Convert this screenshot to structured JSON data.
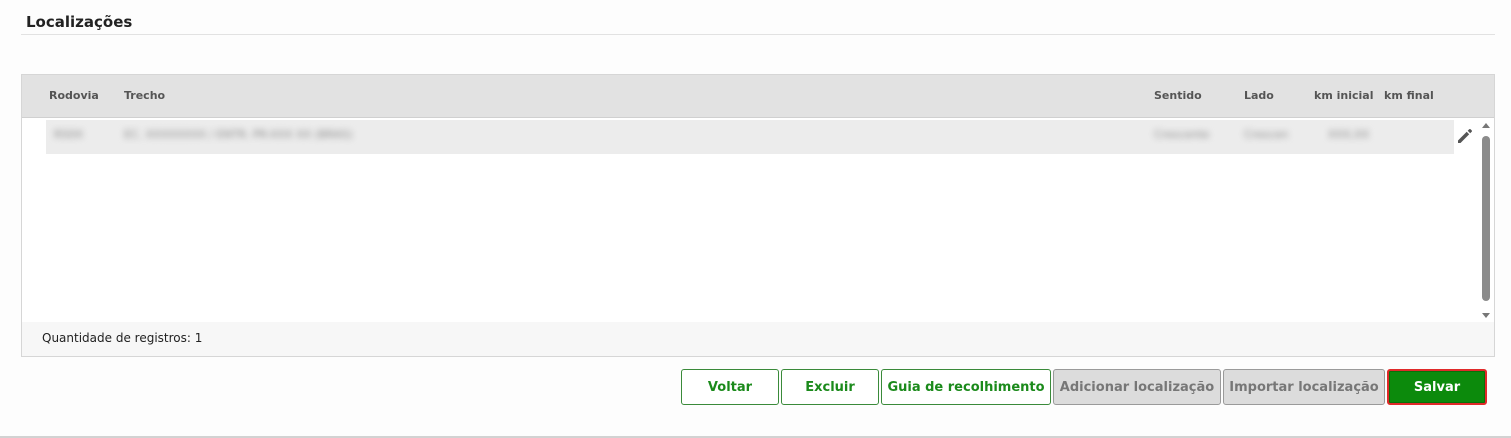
{
  "section": {
    "title": "Localizações"
  },
  "table": {
    "columns": [
      {
        "key": "rodovia",
        "label": "Rodovia"
      },
      {
        "key": "trecho",
        "label": "Trecho"
      },
      {
        "key": "sentido",
        "label": "Sentido"
      },
      {
        "key": "lado",
        "label": "Lado"
      },
      {
        "key": "km_inicial",
        "label": "km inicial"
      },
      {
        "key": "km_final",
        "label": "km final"
      }
    ],
    "rows": [
      {
        "rodovia": "RS0X",
        "trecho": "EC. XXXXXXXX / ENTR. PR-XXX XX (BRAS)",
        "sentido": "Crescente",
        "lado": "Crescen",
        "km_inicial": "XXX,XX",
        "km_final": ""
      }
    ],
    "edit_icon": "pencil-icon",
    "footer": {
      "record_count_text": "Quantidade de registros: 1"
    }
  },
  "actions": {
    "voltar": "Voltar",
    "excluir": "Excluir",
    "guia": "Guia de recolhimento",
    "adicionar": "Adicionar localização",
    "importar": "Importar localização",
    "salvar": "Salvar"
  },
  "colors": {
    "primary": "#0c8a0c",
    "primary_outline": "#1b8a1b",
    "focus_border": "#e02a2a",
    "disabled_bg": "#dcdcdc"
  }
}
